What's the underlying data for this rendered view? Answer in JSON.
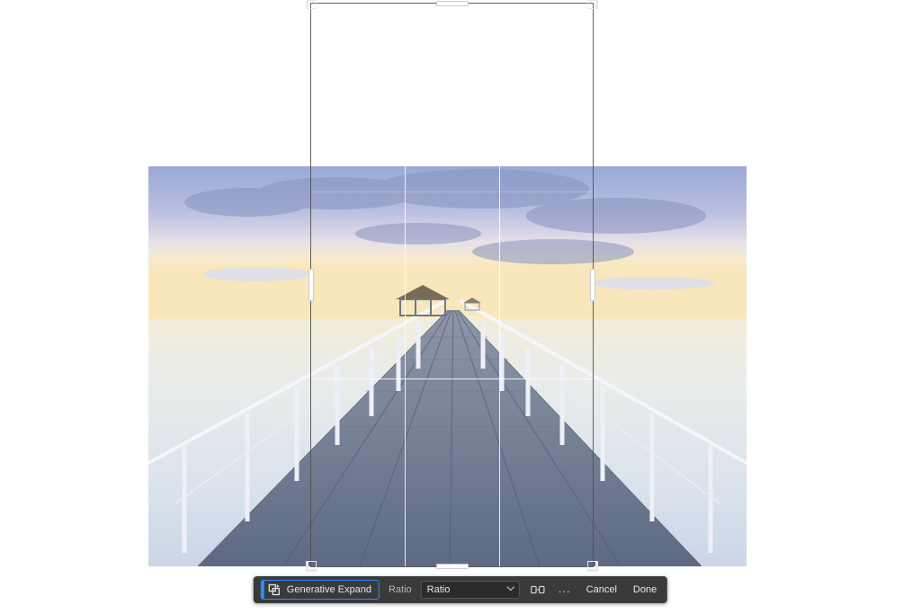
{
  "toolbar": {
    "generative_expand_label": "Generative Expand",
    "ratio_label": "Ratio",
    "ratio_select_value": "Ratio",
    "cancel_label": "Cancel",
    "done_label": "Done",
    "more_label": "..."
  },
  "icons": {
    "generative_expand": "expand-sparkle-icon",
    "clear_fields": "clear-fields-icon",
    "more": "more-icon"
  },
  "crop": {
    "grid": "rule-of-thirds"
  }
}
